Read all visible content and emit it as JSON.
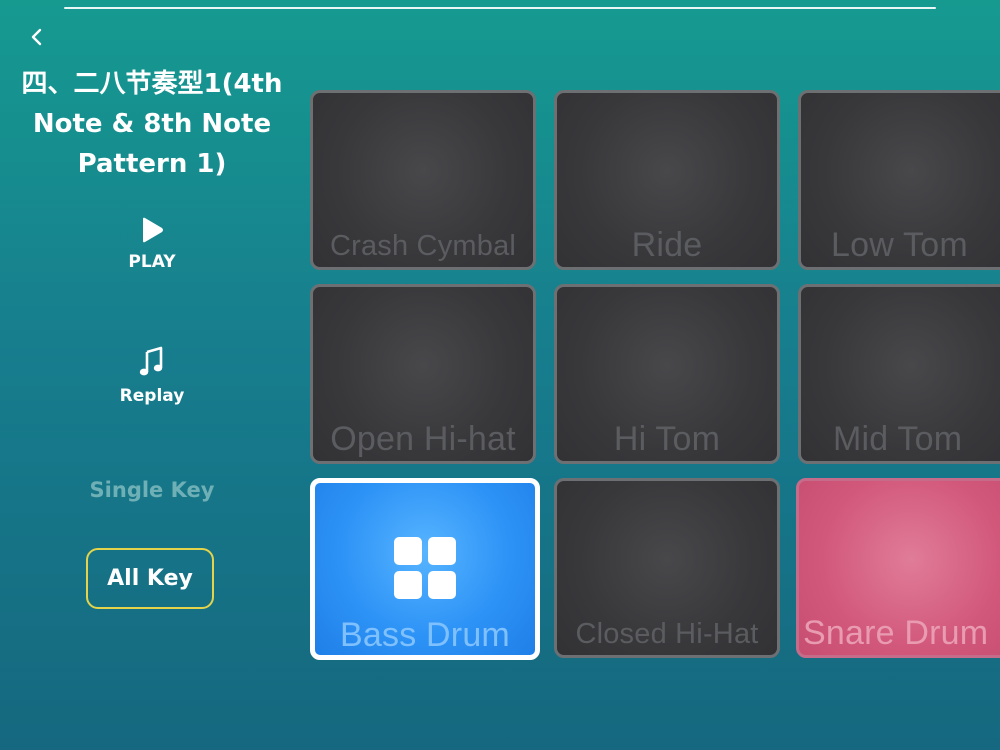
{
  "header": {
    "title_lines": [
      "四、二八节奏型1(4th",
      "Note & 8th Note",
      "Pattern 1)"
    ]
  },
  "icons": {
    "back": "chevron-left-icon",
    "play": "play-icon",
    "replay": "music-note-icon",
    "pad_grid": "grid-icon"
  },
  "controls": {
    "play_label": "PLAY",
    "replay_label": "Replay",
    "single_key_label": "Single Key",
    "all_key_label": "All Key"
  },
  "pads": [
    {
      "label": "Crash Cymbal",
      "state": "default"
    },
    {
      "label": "Ride",
      "state": "default"
    },
    {
      "label": "Low Tom",
      "state": "default"
    },
    {
      "label": "Open Hi-hat",
      "state": "default"
    },
    {
      "label": "Hi Tom",
      "state": "default"
    },
    {
      "label": "Mid Tom",
      "state": "default"
    },
    {
      "label": "Bass Drum",
      "state": "active"
    },
    {
      "label": "Closed Hi-Hat",
      "state": "default"
    },
    {
      "label": "Snare Drum",
      "state": "highlight"
    }
  ],
  "colors": {
    "accent_blue": "#2d93f6",
    "accent_pink": "#d2587b",
    "selected_outline": "#e3d44c",
    "pad_dark": "#38383b"
  }
}
